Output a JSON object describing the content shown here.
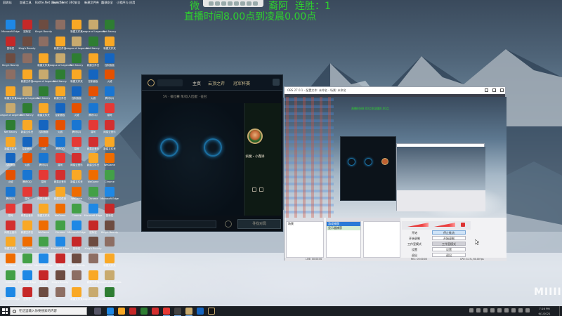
{
  "overlay": {
    "line1": "微",
    "line1b": "裔阿",
    "streak": "连胜：1",
    "line2": "直播时间8.00点到凌晨0.00点"
  },
  "desktop": {
    "top_labels": [
      "回收站",
      "加速工具",
      "Battle.Net\nLauncher",
      "Rum Client",
      "360安全",
      "新建文件夹",
      "圆球安全",
      "小程序与\n应用"
    ],
    "icons": [
      {
        "label": "Microsoft Edge",
        "color": "#1e88e5"
      },
      {
        "label": "鼠标宏",
        "color": "#c62828"
      },
      {
        "label": "King's Bounty",
        "color": "#6d4c41"
      },
      {
        "label": "",
        "color": "#8d6e63"
      },
      {
        "label": "新建文件夹",
        "color": "#f9a825"
      },
      {
        "label": "League of Legends",
        "color": "#c8aa6e"
      },
      {
        "label": "Net Nanny",
        "color": "#2e7d32"
      },
      {
        "label": "新建文件夹",
        "color": "#f9a825"
      },
      {
        "label": "控制面板",
        "color": "#1565c0"
      },
      {
        "label": "火绒",
        "color": "#e65100"
      },
      {
        "label": "腾讯QQ",
        "color": "#1976d2"
      },
      {
        "label": "易阿",
        "color": "#e53935"
      },
      {
        "label": "网易云音乐",
        "color": "#d32f2f"
      },
      {
        "label": "新建文件夹",
        "color": "#f9a825"
      },
      {
        "label": "WeGame",
        "color": "#ef6c00"
      },
      {
        "label": "Chrome",
        "color": "#43a047"
      }
    ]
  },
  "lol_client": {
    "nav_home": "主页",
    "nav_tft": "云顶之弈",
    "nav_clash": "冠军杯赛",
    "lobby_text": "5V · 排位赛 单/双人匹配 · 征召",
    "player_name": "疯魔・小鑫锋",
    "find_match": "寻找对局"
  },
  "obs": {
    "title": "OBS 27.0.1 - 配置文件: 未命名 - 场景: 未命名",
    "preview_overlay": "直播时间8.00点到凌晨0.00点",
    "scenes_header": "场景",
    "scene_item": "场景",
    "sources_header": "来源",
    "source_items": [
      "游戏捕获",
      "显示器捕获"
    ],
    "controls": {
      "start_streaming_label": "开始",
      "start_streaming": "停止推流",
      "recording_label": "开始录制",
      "recording": "开始录制",
      "studio_label": "工作室模式",
      "studio": "工作室模式",
      "settings_label": "设置",
      "settings": "设置",
      "exit_label": "退出",
      "exit": "退出"
    },
    "status": {
      "live": "LIVE: 00:00:00",
      "rec": "REC: 00:00:00",
      "cpu": "CPU: 4.1%, 60.00 fps"
    }
  },
  "watermark": "MIIII",
  "taskbar": {
    "search_placeholder": "在这里输入你要搜索的内容",
    "time": "7:16 PM",
    "date": "6/1/2021"
  }
}
